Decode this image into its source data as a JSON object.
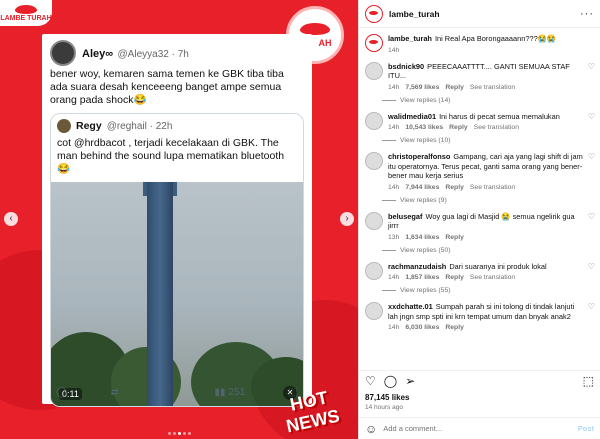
{
  "post_image": {
    "brand_label": "LAMBE TURAH",
    "bubble_label": "AH",
    "hot_news_line1": "HOT",
    "hot_news_line2": "NEWS",
    "tweet": {
      "name": "Aley∞",
      "handle": "@Aleyya32 · 7h",
      "text": "bener woy, kemaren sama temen ke GBK tiba tiba ada suara desah kenceeeng banget ampe semua orang pada shock😂",
      "quote": {
        "name": "Regy",
        "handle": "@reghail · 22h",
        "text": "cot @hrdbacot , terjadi kecelakaan di GBK. The man behind the sound lupa mematikan bluetooth😂",
        "video_time": "0:11"
      },
      "actions": {
        "views": "251"
      }
    }
  },
  "panel": {
    "header_user": "lambe_turah",
    "caption": {
      "user": "lambe_turah",
      "text": "Ini Real Apa Borongaaaann???😭😭",
      "time": "14h"
    },
    "comments": [
      {
        "user": "bsdnick90",
        "text": "PEEECAAATTTT.... GANTI SEMUAA STAF ITU...",
        "time": "14h",
        "likes": "7,569 likes",
        "reply": "Reply",
        "translate": "See translation",
        "view_replies": "View replies (14)"
      },
      {
        "user": "walidmedia01",
        "text": "Ini harus di pecat semua memalukan",
        "time": "14h",
        "likes": "10,543 likes",
        "reply": "Reply",
        "translate": "See translation",
        "view_replies": "View replies (10)"
      },
      {
        "user": "christoperalfonso",
        "text": "Gampang, cari aja yang lagi shift di jam itu operatornya. Terus pecat, ganti sama orang yang bener-bener mau kerja serius",
        "time": "14h",
        "likes": "7,944 likes",
        "reply": "Reply",
        "translate": "See translation",
        "view_replies": "View replies (9)"
      },
      {
        "user": "belusegaf",
        "text": "Woy gua lagi di Masjid 😭 semua ngelirik gua jirrr",
        "time": "13h",
        "likes": "1,634 likes",
        "reply": "Reply",
        "translate": "",
        "view_replies": "View replies (50)"
      },
      {
        "user": "rachmanzudaish",
        "text": "Dari suaranya ini produk lokal",
        "time": "14h",
        "likes": "1,857 likes",
        "reply": "Reply",
        "translate": "See translation",
        "view_replies": "View replies (55)"
      },
      {
        "user": "xxdchatte.01",
        "text": "Sumpah parah si ini tolong di tindak lanjuti lah jngn smp spti ini krn tempat umum dan bnyak anak2",
        "time": "14h",
        "likes": "6,030 likes",
        "reply": "Reply",
        "translate": "",
        "view_replies": ""
      }
    ],
    "likes_count": "87,145 likes",
    "posted_ago": "14 hours ago",
    "add_comment_placeholder": "Add a comment...",
    "post_label": "Post"
  },
  "colors": {
    "brand_red": "#e8202a"
  },
  "icons": [
    "heart-icon",
    "comment-icon",
    "share-icon",
    "save-icon",
    "more-icon",
    "emoji-icon",
    "close-icon",
    "chevron-left-icon",
    "chevron-right-icon",
    "mute-icon"
  ]
}
